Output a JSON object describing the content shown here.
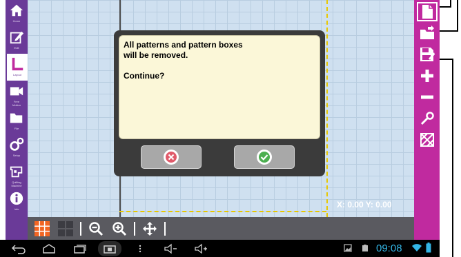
{
  "nav": {
    "items": [
      {
        "label": "Home"
      },
      {
        "label": "Edit"
      },
      {
        "label": "Layout"
      },
      {
        "label": "Free\nMotion"
      },
      {
        "label": "File"
      },
      {
        "label": "Setup"
      },
      {
        "label": "Quilting\nMachine"
      },
      {
        "label": "Info"
      }
    ]
  },
  "canvas": {
    "coords": "X: 0.00 Y: 0.00"
  },
  "dialog": {
    "message": "All patterns and pattern boxes\nwill be removed.\n\nContinue?"
  },
  "status_bar": {
    "time": "09:08"
  },
  "colors": {
    "left_sidebar": "#6a3a98",
    "right_toolbar": "#c02a9f",
    "canvas": "#cfe0f0",
    "dialog_body": "#fbf7d8",
    "accent_orange": "#f26522"
  }
}
